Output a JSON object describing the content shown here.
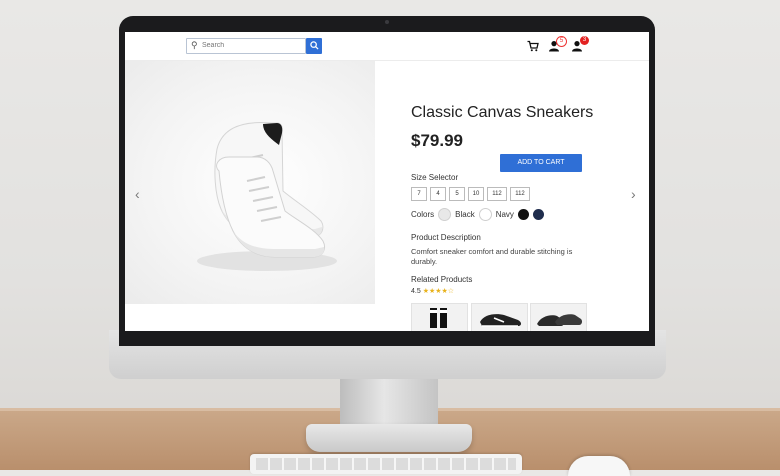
{
  "header": {
    "search_placeholder": "Search",
    "notifications_count": "5",
    "account_count": "3"
  },
  "product": {
    "title": "Classic Canvas Sneakers",
    "price": "$79.99",
    "add_to_cart_label": "ADD TO CART",
    "size_label": "Size Selector",
    "sizes": [
      "7",
      "4",
      "5",
      "10",
      "112",
      "112"
    ],
    "colors_label": "Colors",
    "colors": [
      {
        "name": "Black",
        "hex": "#e8e8e8"
      },
      {
        "name": "Navy",
        "hex": "#ffffff"
      }
    ],
    "extra_swatches": [
      "#111111",
      "#1f2d4d"
    ],
    "description_title": "Product Description",
    "description_text": "Comfort sneaker comfort and durable stitching is durably.",
    "related_title": "Related Products",
    "rating_value": "4.5",
    "rating_stars": "★★★★☆"
  },
  "colors": {
    "accent": "#2f6fd6",
    "badge": "#e32222"
  }
}
